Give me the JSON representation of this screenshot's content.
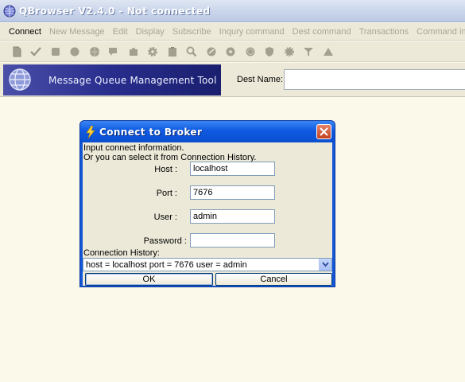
{
  "window": {
    "title": "QBrowser V2.4.0 - Not connected"
  },
  "menubar": {
    "items": [
      {
        "label": "Connect",
        "active": true
      },
      {
        "label": "New Message",
        "active": false
      },
      {
        "label": "Edit",
        "active": false
      },
      {
        "label": "Display",
        "active": false
      },
      {
        "label": "Subscribe",
        "active": false
      },
      {
        "label": "Inqury command",
        "active": false
      },
      {
        "label": "Dest command",
        "active": false
      },
      {
        "label": "Transactions",
        "active": false
      },
      {
        "label": "Command input",
        "active": false
      }
    ]
  },
  "toolbar": {
    "icons": [
      "page-icon",
      "check-icon",
      "square-icon",
      "circle-icon",
      "globe-icon",
      "chat-icon",
      "puzzle-icon",
      "gear-icon",
      "clipboard-icon",
      "magnifier-icon",
      "link-icon",
      "disc-icon",
      "coin-icon",
      "shield-icon",
      "star-icon",
      "filter-icon",
      "triangle-icon"
    ]
  },
  "header": {
    "brand_text": "Message Queue Management Tool",
    "dest_label": "Dest Name:",
    "dest_value": ""
  },
  "dialog": {
    "title": "Connect to Broker",
    "info_line1": "Input connect information.",
    "info_line2": "Or you can select it from Connection History.",
    "host_label": "Host  :",
    "host_value": "localhost",
    "port_label": "Port  :",
    "port_value": "7676",
    "user_label": "User  :",
    "user_value": "admin",
    "password_label": "Password  :",
    "password_value": "",
    "history_label": "Connection History:",
    "history_value": "host = localhost port = 7676 user = admin",
    "ok_label": "OK",
    "cancel_label": "Cancel"
  },
  "colors": {
    "accent": "#0a4fd0",
    "background": "#fbf9e9",
    "brand_panel": "#282d8c"
  }
}
